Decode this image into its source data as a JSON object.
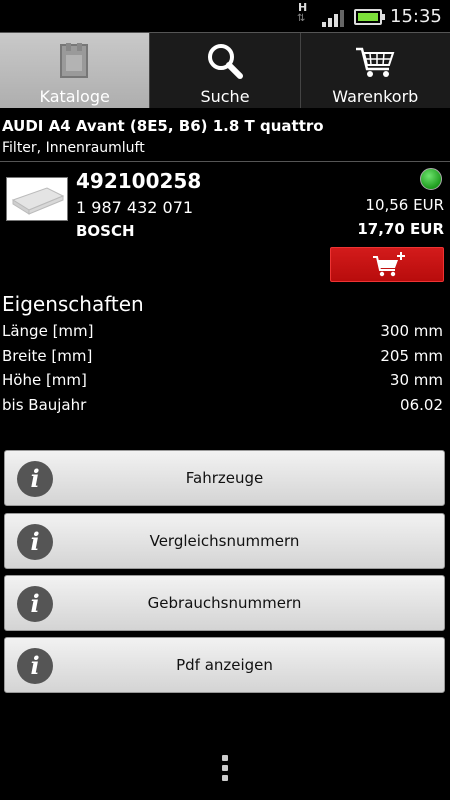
{
  "status_bar": {
    "network_type": "H",
    "time": "15:35"
  },
  "tabs": [
    {
      "label": "Kataloge",
      "icon": "catalog-icon",
      "active": true
    },
    {
      "label": "Suche",
      "icon": "search-icon",
      "active": false
    },
    {
      "label": "Warenkorb",
      "icon": "cart-icon",
      "active": false
    }
  ],
  "header": {
    "vehicle": "AUDI A4 Avant (8E5, B6) 1.8 T quattro",
    "category": "Filter, Innenraumluft"
  },
  "product": {
    "number": "492100258",
    "code": "1 987 432 071",
    "brand": "BOSCH",
    "price_1": "10,56 EUR",
    "price_2": "17,70 EUR",
    "availability_color": "#2bb52b"
  },
  "properties": {
    "title": "Eigenschaften",
    "rows": [
      {
        "key": "Länge [mm]",
        "value": "300 mm"
      },
      {
        "key": "Breite [mm]",
        "value": "205 mm"
      },
      {
        "key": "Höhe [mm]",
        "value": "30 mm"
      },
      {
        "key": "bis Baujahr",
        "value": "06.02"
      }
    ]
  },
  "info_buttons": [
    {
      "label": "Fahrzeuge"
    },
    {
      "label": "Vergleichsnummern"
    },
    {
      "label": "Gebrauchsnummern"
    },
    {
      "label": "Pdf anzeigen"
    }
  ],
  "colors": {
    "cart_button": "#c41414",
    "active_tab": "#bcbcbc"
  }
}
